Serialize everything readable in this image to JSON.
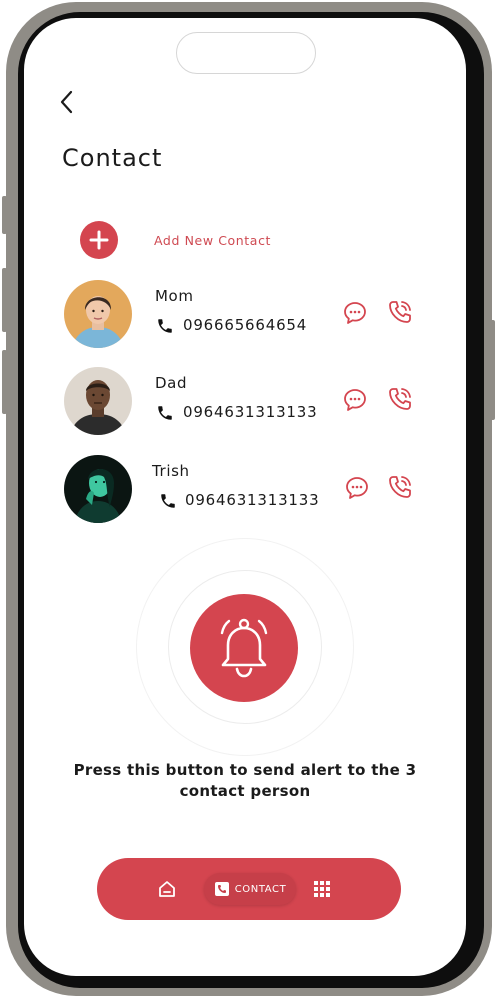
{
  "header": {
    "title": "Contact"
  },
  "add_contact": {
    "label": "Add New Contact"
  },
  "contacts": [
    {
      "name": "Mom",
      "phone": "096665664654"
    },
    {
      "name": "Dad",
      "phone": "0964631313133"
    },
    {
      "name": "Trish",
      "phone": "0964631313133"
    }
  ],
  "alert": {
    "description": "Press this button to send alert to the 3 contact person"
  },
  "bottom_nav": {
    "items": [
      {
        "icon": "home-icon"
      },
      {
        "icon": "contact-icon",
        "label": "CONTACT",
        "active": true
      },
      {
        "icon": "grid-icon"
      }
    ]
  },
  "colors": {
    "accent": "#d4454f",
    "text": "#1b1b1b"
  }
}
